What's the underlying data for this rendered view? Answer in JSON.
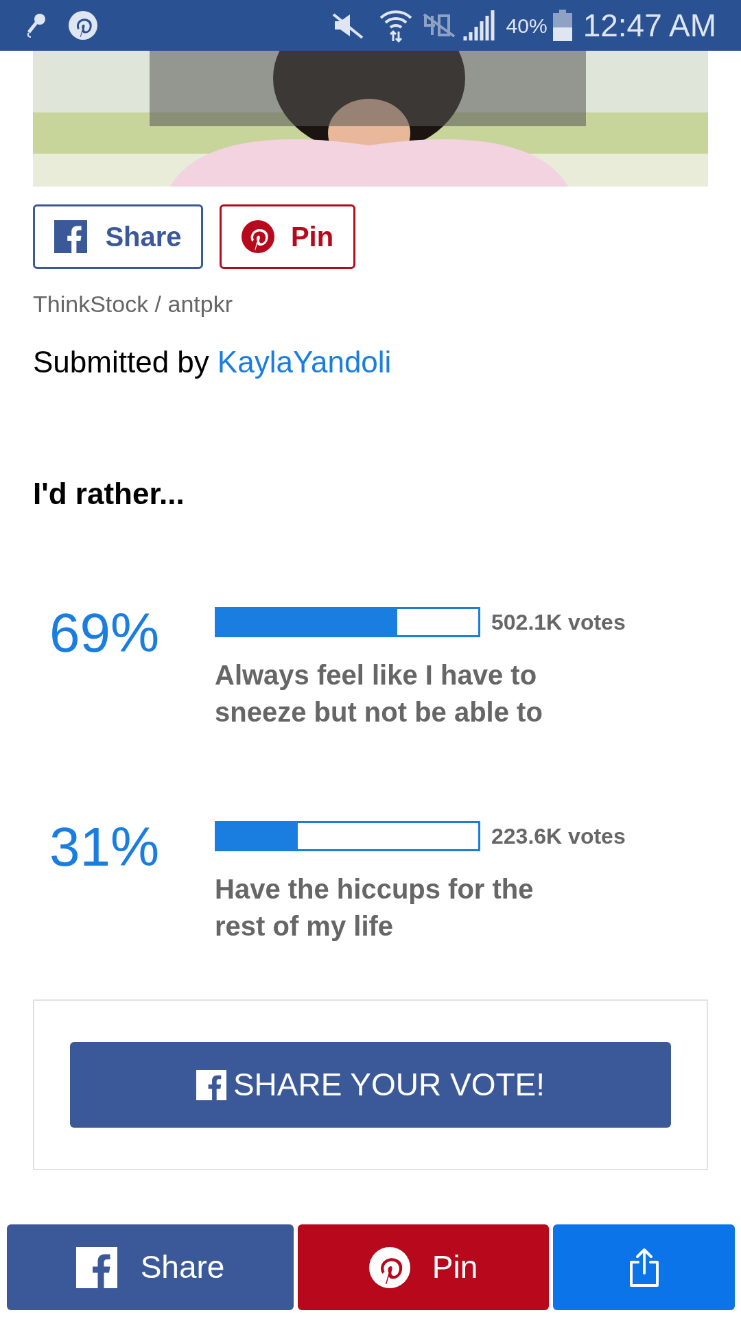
{
  "status_bar": {
    "battery": "40%",
    "time": "12:47 AM"
  },
  "share_buttons": [
    {
      "kind": "facebook",
      "label": "Share"
    },
    {
      "kind": "pinterest",
      "label": "Pin"
    }
  ],
  "credit": "ThinkStock / antpkr",
  "submitted": {
    "prefix": "Submitted by",
    "author": "KaylaYandoli"
  },
  "poll": {
    "question": "I'd rather...",
    "options": [
      {
        "percent": "69%",
        "level": 0.69,
        "votes": "502.1K votes",
        "text": "Always feel like I have to sneeze but not be able to"
      },
      {
        "percent": "31%",
        "level": 0.31,
        "votes": "223.6K votes",
        "text": "Have the hiccups for the rest of my life"
      }
    ]
  },
  "share_vote": {
    "label": "SHARE YOUR VOTE!"
  },
  "bottom_bar": [
    {
      "kind": "facebook",
      "label": "Share"
    },
    {
      "kind": "pinterest",
      "label": "Pin"
    },
    {
      "kind": "share"
    }
  ]
}
